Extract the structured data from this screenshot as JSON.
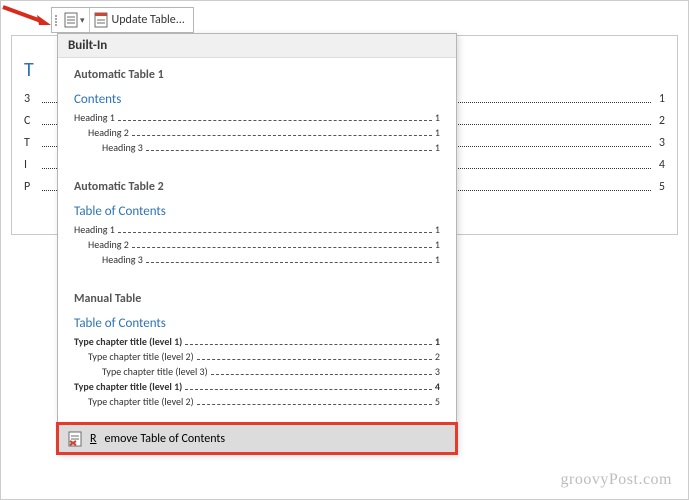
{
  "toolbar": {
    "update_label": "Update Table..."
  },
  "background_toc": {
    "title": "T",
    "rows": [
      {
        "pre": "3",
        "page": "1"
      },
      {
        "pre": "C",
        "page": "2"
      },
      {
        "pre": "T",
        "page": "3"
      },
      {
        "pre": "I",
        "page": "4"
      },
      {
        "pre": "P",
        "page": "5"
      }
    ]
  },
  "menu": {
    "section_header": "Built-In",
    "auto1": {
      "title": "Automatic Table 1",
      "caption": "Contents",
      "rows": [
        {
          "label": "Heading 1",
          "page": "1",
          "indent": 0
        },
        {
          "label": "Heading 2",
          "page": "1",
          "indent": 1
        },
        {
          "label": "Heading 3",
          "page": "1",
          "indent": 2
        }
      ]
    },
    "auto2": {
      "title": "Automatic Table 2",
      "caption": "Table of Contents",
      "rows": [
        {
          "label": "Heading 1",
          "page": "1",
          "indent": 0
        },
        {
          "label": "Heading 2",
          "page": "1",
          "indent": 1
        },
        {
          "label": "Heading 3",
          "page": "1",
          "indent": 2
        }
      ]
    },
    "manual": {
      "title": "Manual Table",
      "caption": "Table of Contents",
      "rows": [
        {
          "label": "Type chapter title (level 1)",
          "page": "1",
          "indent": 0,
          "bold": true
        },
        {
          "label": "Type chapter title (level 2)",
          "page": "2",
          "indent": 1
        },
        {
          "label": "Type chapter title (level 3)",
          "page": "3",
          "indent": 2
        },
        {
          "label": "Type chapter title (level 1)",
          "page": "4",
          "indent": 0,
          "bold": true
        },
        {
          "label": "Type chapter title (level 2)",
          "page": "5",
          "indent": 1
        }
      ]
    },
    "remove_label": "Remove Table of Contents"
  },
  "watermark": "groovyPost.com"
}
